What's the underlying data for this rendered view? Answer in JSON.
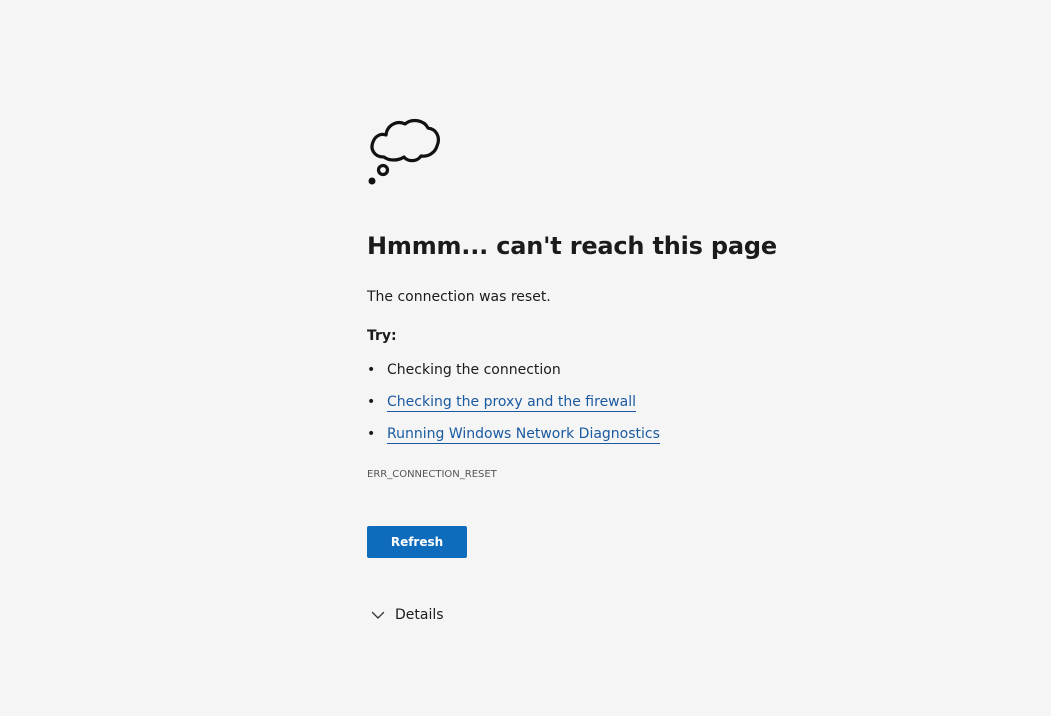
{
  "title": "Hmmm... can't reach this page",
  "message": "The connection was reset.",
  "try_heading": "Try:",
  "suggestions": [
    {
      "label": "Checking the connection",
      "is_link": false
    },
    {
      "label": "Checking the proxy and the firewall",
      "is_link": true
    },
    {
      "label": "Running Windows Network Diagnostics",
      "is_link": true
    }
  ],
  "bullet": "•",
  "error_code": "ERR_CONNECTION_RESET",
  "refresh_label": "Refresh",
  "details_label": "Details",
  "icons": {
    "main": "thought-cloud-icon",
    "details": "chevron-down-icon"
  },
  "colors": {
    "background": "#f5f5f5",
    "text": "#1b1b1b",
    "link": "#1a5aa0",
    "button": "#0f6cbd",
    "button_text": "#ffffff"
  }
}
